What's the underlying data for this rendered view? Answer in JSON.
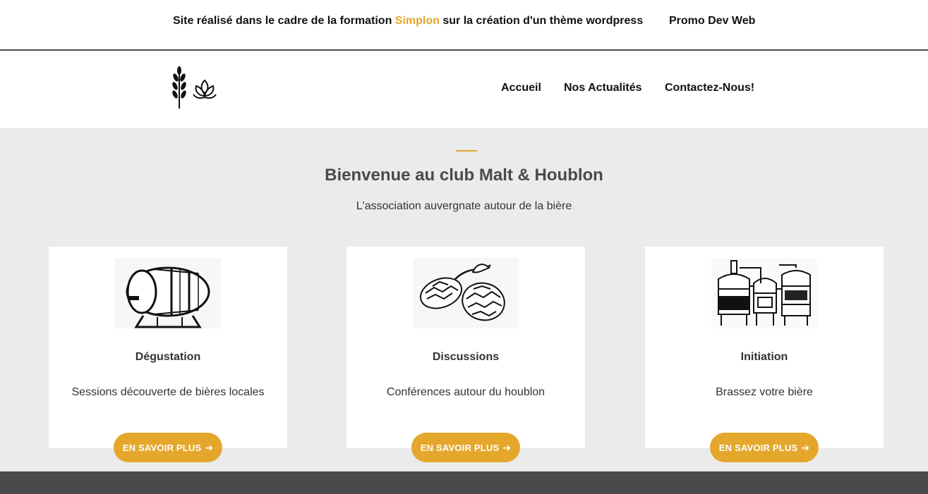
{
  "topbar": {
    "text_before": "Site réalisé dans le cadre de la formation ",
    "accent": "Simplon",
    "text_after": " sur la création d'un thème wordpress",
    "promo": "Promo Dev Web",
    "accent_color": "#e4a72c"
  },
  "header": {
    "logo_icon": "wheat-and-hop-logo",
    "nav": [
      {
        "label": "Accueil"
      },
      {
        "label": "Nos Actualités"
      },
      {
        "label": "Contactez-Nous!"
      }
    ]
  },
  "hero": {
    "title": "Bienvenue au club Malt & Houblon",
    "subtitle": "L'association auvergnate autour de la bière",
    "background": "#ebebeb"
  },
  "cards": [
    {
      "image": "barrel-illustration",
      "title": "Dégustation",
      "description": "Sessions découverte de bières locales",
      "button": "EN SAVOIR PLUS",
      "button_icon": "arrow-right-icon"
    },
    {
      "image": "hops-illustration",
      "title": "Discussions",
      "description": "Conférences autour du houblon",
      "button": "EN SAVOIR PLUS",
      "button_icon": "arrow-right-icon"
    },
    {
      "image": "brewing-equipment-illustration",
      "title": "Initiation",
      "description": "Brassez votre bière",
      "button": "EN SAVOIR PLUS",
      "button_icon": "arrow-right-icon"
    }
  ],
  "colors": {
    "accent": "#e4a72c",
    "footer": "#4a4a4a"
  }
}
